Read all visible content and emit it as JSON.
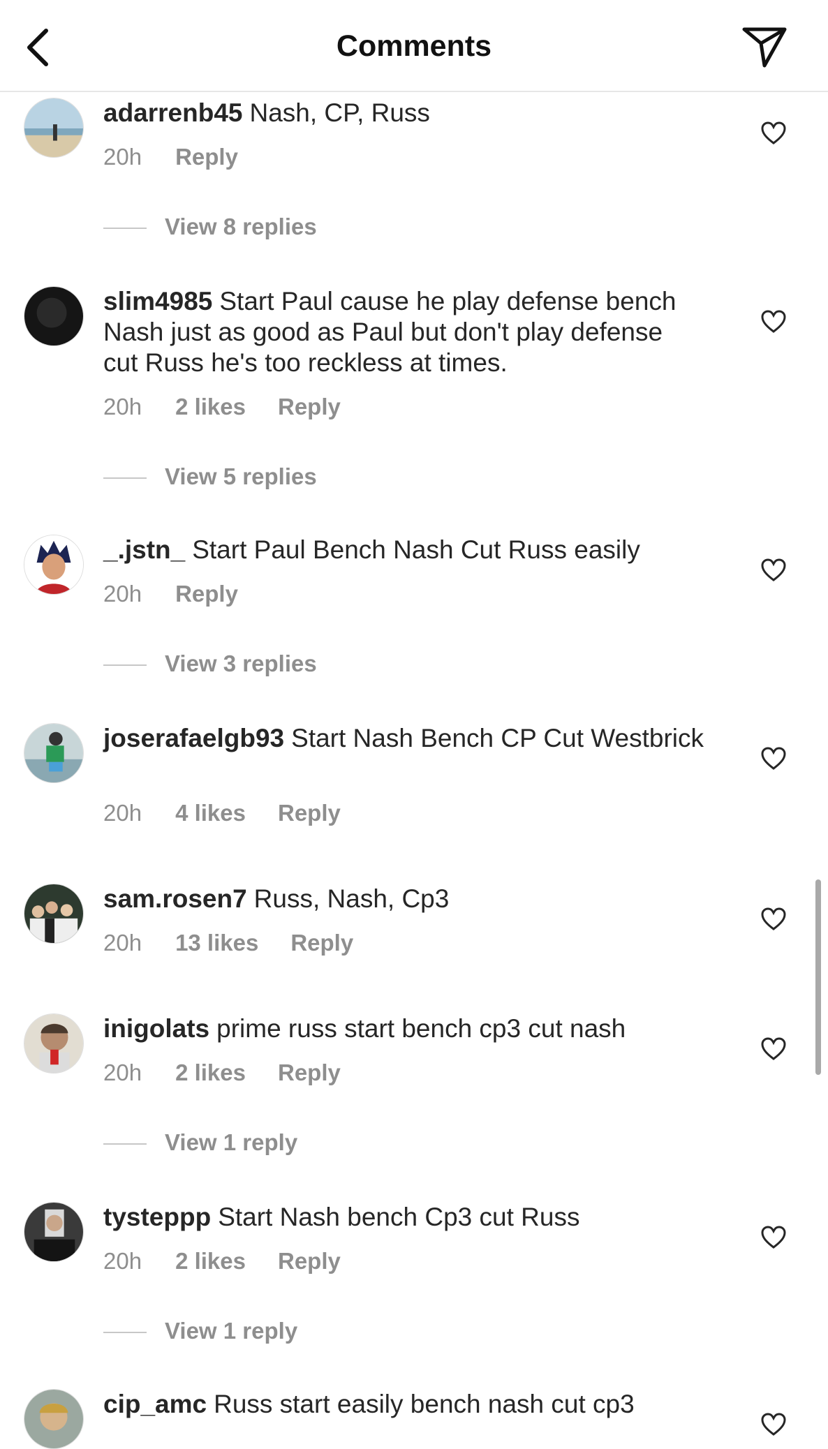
{
  "header": {
    "title": "Comments",
    "back_icon": "chevron-left-icon",
    "send_icon": "paper-plane-icon"
  },
  "comments": [
    {
      "username": "adarrenb45",
      "text": "Nash, CP, Russ",
      "time": "20h",
      "likes": "",
      "reply": "Reply",
      "view_replies": "View 8 replies"
    },
    {
      "username": "slim4985",
      "text": "Start Paul cause he play defense bench Nash just as good as Paul but don't play defense cut Russ he's too reckless at times.",
      "time": "20h",
      "likes": "2 likes",
      "reply": "Reply",
      "view_replies": "View 5 replies"
    },
    {
      "username": "_.jstn_",
      "text": "Start Paul Bench Nash Cut Russ easily",
      "time": "20h",
      "likes": "",
      "reply": "Reply",
      "view_replies": "View 3 replies"
    },
    {
      "username": "joserafaelgb93",
      "text": "Start Nash Bench CP Cut Westbrick",
      "time": "20h",
      "likes": "4 likes",
      "reply": "Reply",
      "view_replies": ""
    },
    {
      "username": "sam.rosen7",
      "text": "Russ, Nash, Cp3",
      "time": "20h",
      "likes": "13 likes",
      "reply": "Reply",
      "view_replies": ""
    },
    {
      "username": "inigolats",
      "text": "prime russ start bench cp3 cut nash",
      "time": "20h",
      "likes": "2 likes",
      "reply": "Reply",
      "view_replies": "View 1 reply"
    },
    {
      "username": "tysteppp",
      "text": "Start Nash bench Cp3 cut Russ",
      "time": "20h",
      "likes": "2 likes",
      "reply": "Reply",
      "view_replies": "View 1 reply"
    },
    {
      "username": "cip_amc",
      "text": "Russ start easily bench nash cut cp3",
      "time": "",
      "likes": "",
      "reply": "",
      "view_replies": ""
    }
  ],
  "colors": {
    "text": "#262626",
    "muted": "#8e8e8e",
    "divider": "#e6e6e6"
  }
}
